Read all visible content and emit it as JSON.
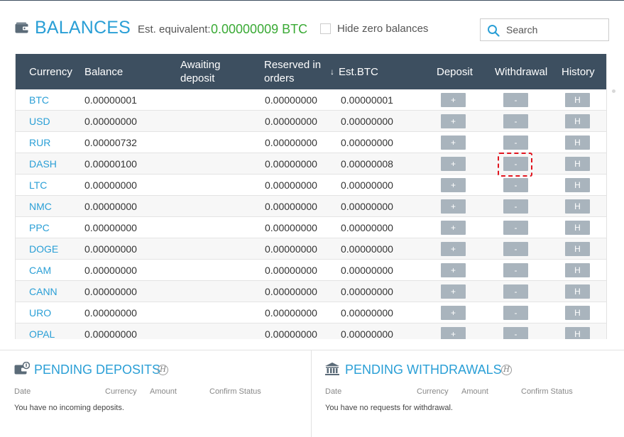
{
  "page": {
    "title": "BALANCES"
  },
  "estimate": {
    "label": "Est. equivalent:",
    "value": "0.00000009 BTC"
  },
  "filters": {
    "hide_zero_label": "Hide zero balances",
    "hide_zero_checked": false
  },
  "search": {
    "placeholder": "Search"
  },
  "table": {
    "columns": {
      "currency": "Currency",
      "balance": "Balance",
      "awaiting": "Awaiting deposit",
      "reserved": "Reserved in orders",
      "est_btc": "Est.BTC",
      "deposit": "Deposit",
      "withdrawal": "Withdrawal",
      "history": "History"
    },
    "sort_icon": "arrow-down-icon",
    "button_labels": {
      "deposit": "+",
      "withdrawal": "-",
      "history": "H"
    },
    "rows": [
      {
        "currency": "BTC",
        "balance": "0.00000001",
        "awaiting": "",
        "reserved": "0.00000000",
        "est_btc": "0.00000001"
      },
      {
        "currency": "USD",
        "balance": "0.00000000",
        "awaiting": "",
        "reserved": "0.00000000",
        "est_btc": "0.00000000"
      },
      {
        "currency": "RUR",
        "balance": "0.00000732",
        "awaiting": "",
        "reserved": "0.00000000",
        "est_btc": "0.00000000"
      },
      {
        "currency": "DASH",
        "balance": "0.00000100",
        "awaiting": "",
        "reserved": "0.00000000",
        "est_btc": "0.00000008"
      },
      {
        "currency": "LTC",
        "balance": "0.00000000",
        "awaiting": "",
        "reserved": "0.00000000",
        "est_btc": "0.00000000"
      },
      {
        "currency": "NMC",
        "balance": "0.00000000",
        "awaiting": "",
        "reserved": "0.00000000",
        "est_btc": "0.00000000"
      },
      {
        "currency": "PPC",
        "balance": "0.00000000",
        "awaiting": "",
        "reserved": "0.00000000",
        "est_btc": "0.00000000"
      },
      {
        "currency": "DOGE",
        "balance": "0.00000000",
        "awaiting": "",
        "reserved": "0.00000000",
        "est_btc": "0.00000000"
      },
      {
        "currency": "CAM",
        "balance": "0.00000000",
        "awaiting": "",
        "reserved": "0.00000000",
        "est_btc": "0.00000000"
      },
      {
        "currency": "CANN",
        "balance": "0.00000000",
        "awaiting": "",
        "reserved": "0.00000000",
        "est_btc": "0.00000000"
      },
      {
        "currency": "URO",
        "balance": "0.00000000",
        "awaiting": "",
        "reserved": "0.00000000",
        "est_btc": "0.00000000"
      },
      {
        "currency": "OPAL",
        "balance": "0.00000000",
        "awaiting": "",
        "reserved": "0.00000000",
        "est_btc": "0.00000000"
      }
    ]
  },
  "pending_deposits": {
    "title": "PENDING DEPOSITS",
    "info_badge": "H",
    "columns": {
      "date": "Date",
      "currency": "Currency",
      "amount": "Amount",
      "status": "Confirm Status"
    },
    "empty_message": "You have no incoming deposits."
  },
  "pending_withdrawals": {
    "title": "PENDING WITHDRAWALS",
    "info_badge": "H",
    "columns": {
      "date": "Date",
      "currency": "Currency",
      "amount": "Amount",
      "status": "Confirm Status"
    },
    "empty_message": "You have no requests for withdrawal."
  },
  "colors": {
    "accent": "#2a9fd6",
    "header_bg": "#3d4f60",
    "positive": "#3aaa35",
    "button_bg": "#a9b4bd",
    "highlight": "#e0141e"
  }
}
